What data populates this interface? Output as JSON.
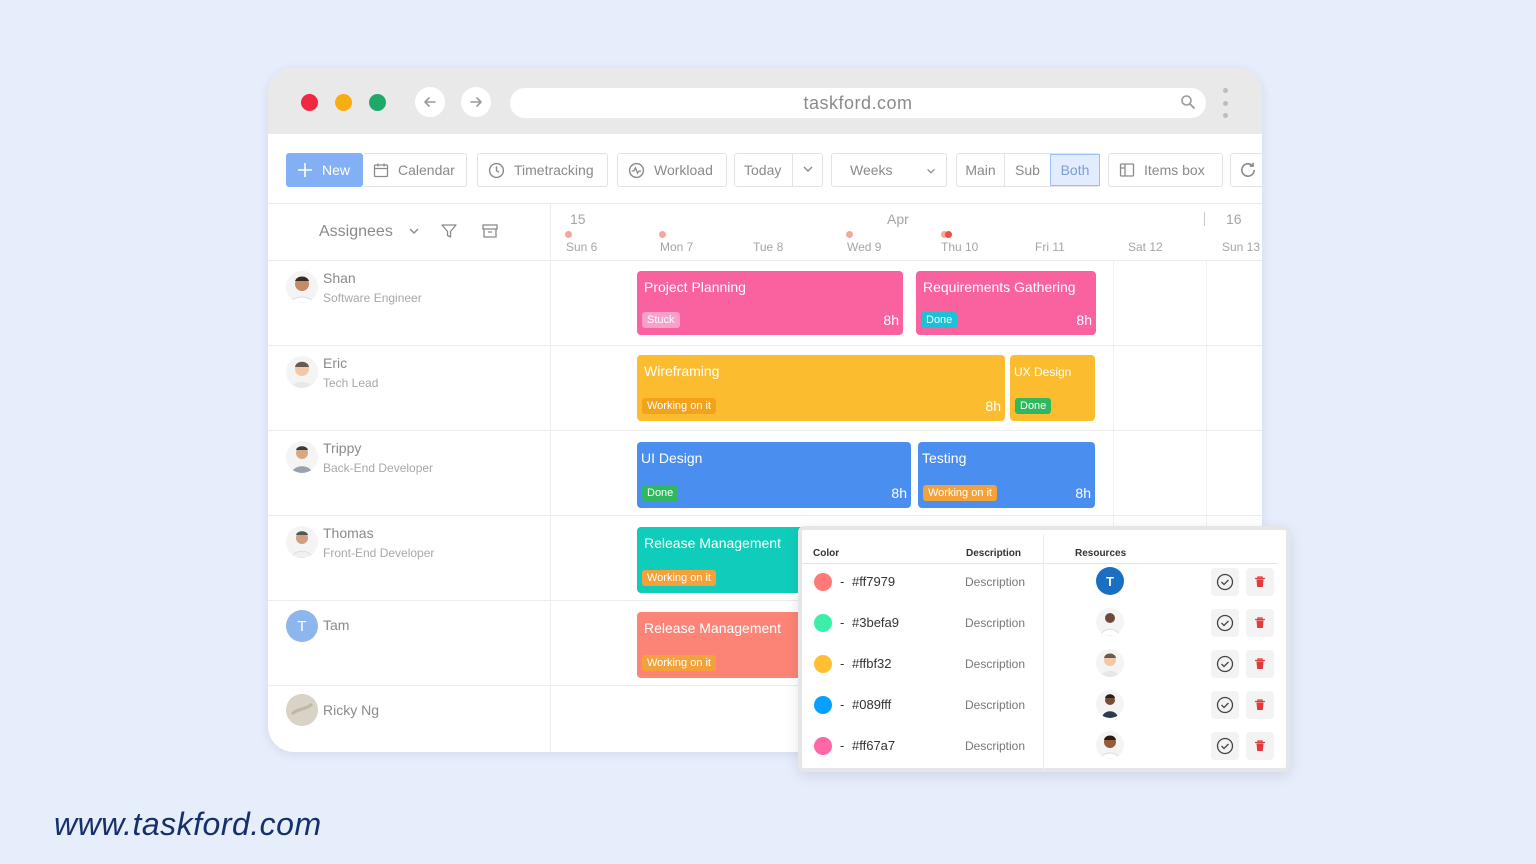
{
  "browser": {
    "url": "taskford.com",
    "colors": {
      "close": "#ef2a40",
      "minimize": "#f7ae12",
      "maximize": "#1ea86a"
    }
  },
  "toolbar": {
    "new_label": "New",
    "calendar_label": "Calendar",
    "timetracking_label": "Timetracking",
    "workload_label": "Workload",
    "today_label": "Today",
    "weeks_label": "Weeks",
    "main_label": "Main",
    "sub_label": "Sub",
    "both_label": "Both",
    "itemsbox_label": "Items box"
  },
  "header": {
    "assignees_label": "Assignees",
    "week_left": "15",
    "month": "Apr",
    "week_right": "16",
    "days": [
      "Sun 6",
      "Mon 7",
      "Tue 8",
      "Wed 9",
      "Thu 10",
      "Fri 11",
      "Sat 12",
      "Sun 13"
    ]
  },
  "people": [
    {
      "name": "Shan",
      "role": "Software Engineer"
    },
    {
      "name": "Eric",
      "role": "Tech Lead"
    },
    {
      "name": "Trippy",
      "role": "Back-End Developer"
    },
    {
      "name": "Thomas",
      "role": "Front-End Developer"
    },
    {
      "name": "Tam",
      "role": "",
      "initial": "T"
    },
    {
      "name": "Ricky Ng",
      "role": ""
    }
  ],
  "tasks": [
    {
      "name": "Project Planning",
      "status": "Stuck",
      "hours": "8h",
      "color": "#f9619f",
      "badge_color": "#fb9fcb"
    },
    {
      "name": "Requirements Gathering",
      "status": "Done",
      "hours": "8h",
      "color": "#f9619f",
      "badge_color": "#19c2d6"
    },
    {
      "name": "Wireframing",
      "status": "Working on it",
      "hours": "8h",
      "color": "#fbbd2f",
      "badge_color": "#f3a21c"
    },
    {
      "name": "UX Design",
      "status": "Done",
      "hours": "",
      "color": "#fbbd2f",
      "badge_color": "#2fb85d"
    },
    {
      "name": "UI Design",
      "status": "Done",
      "hours": "8h",
      "color": "#4a8ef0",
      "badge_color": "#2fb85d"
    },
    {
      "name": "Testing",
      "status": "Working on it",
      "hours": "8h",
      "color": "#4a8ef0",
      "badge_color": "#f5a13a"
    },
    {
      "name": "Release Management",
      "status": "Working on it",
      "hours": "",
      "color": "#10cdbb",
      "badge_color": "#f5a13a"
    },
    {
      "name": "Release Management",
      "status": "Working on it",
      "hours": "",
      "color": "#fb8476",
      "badge_color": "#f5a13a"
    }
  ],
  "popup": {
    "headers": {
      "color": "Color",
      "description": "Description",
      "resources": "Resources"
    },
    "rows": [
      {
        "hex": "#ff7979",
        "description": "Description",
        "resource_initial": "T"
      },
      {
        "hex": "#3befa9",
        "description": "Description"
      },
      {
        "hex": "#ffbf32",
        "description": "Description"
      },
      {
        "hex": "#089fff",
        "description": "Description"
      },
      {
        "hex": "#ff67a7",
        "description": "Description"
      }
    ]
  },
  "footer": {
    "site": "www.taskford.com"
  }
}
